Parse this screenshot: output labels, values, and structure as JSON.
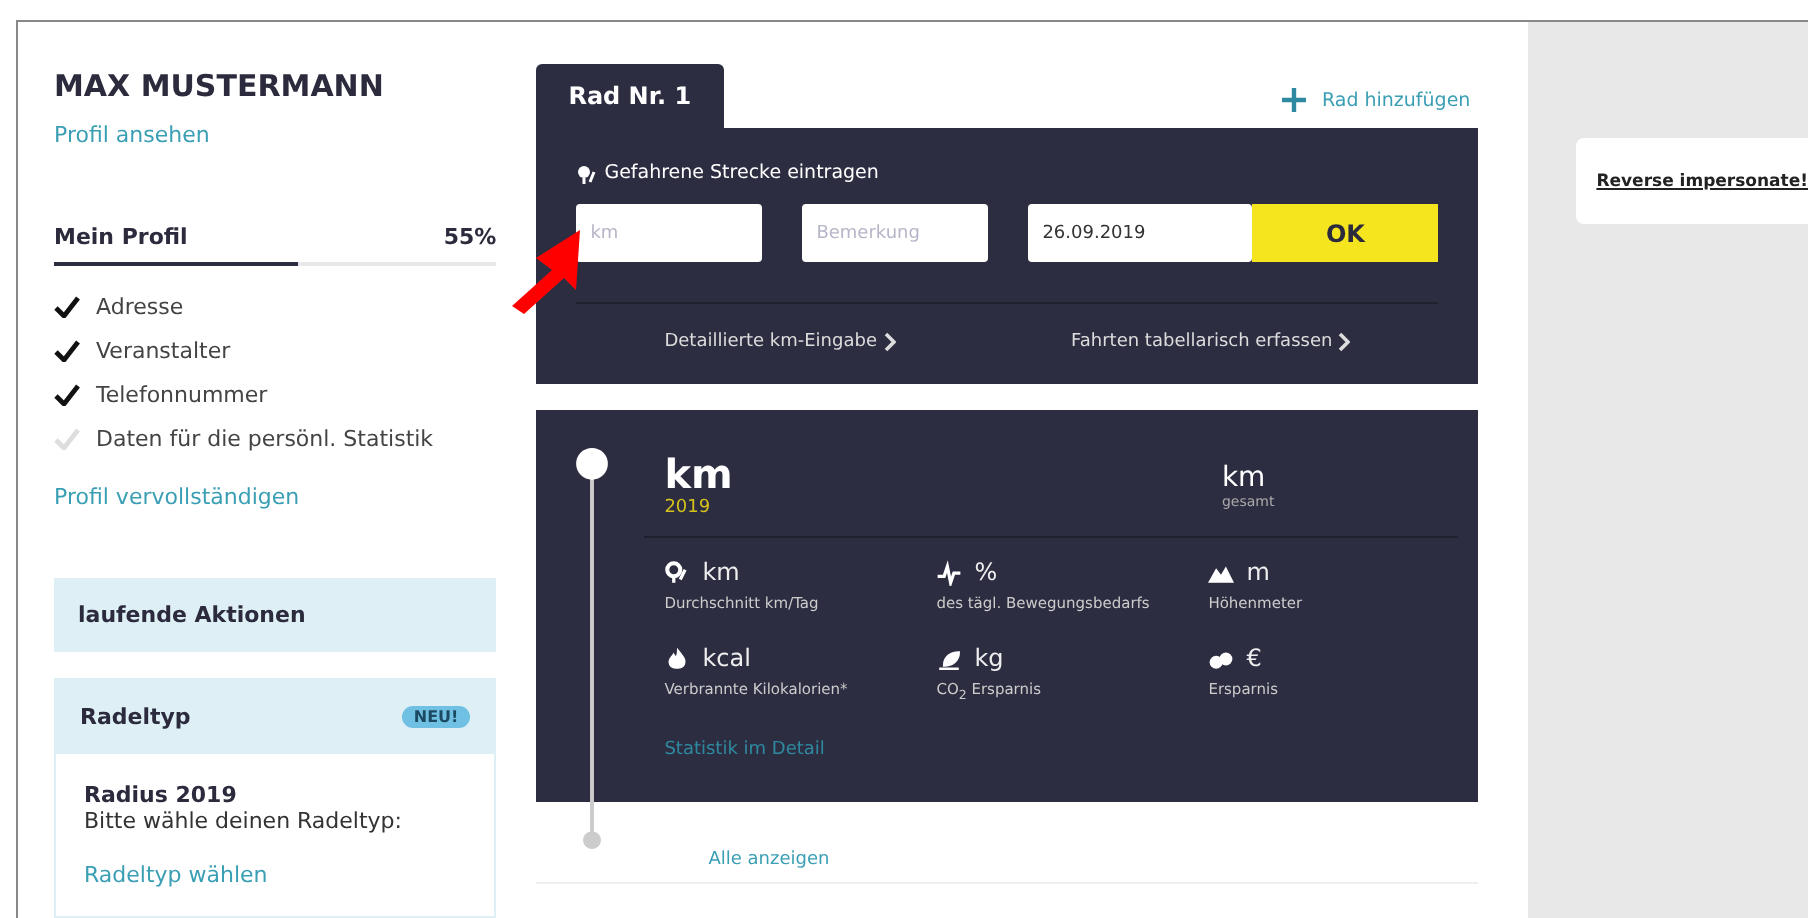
{
  "profile": {
    "name": "MAX MUSTERMANN",
    "view_link": "Profil ansehen",
    "progress_label": "Mein Profil",
    "progress_reading": "55%",
    "level": 0.55,
    "checklist": [
      {
        "label": "Adresse",
        "checked": true
      },
      {
        "label": "Veranstalter",
        "checked": true
      },
      {
        "label": "Telefonnummer",
        "checked": true
      },
      {
        "label": "Daten für die persönl. Statistik",
        "checked": false
      }
    ],
    "complete_link": "Profil vervollständigen"
  },
  "campaigns": {
    "title": "laufende Aktionen"
  },
  "cyclist_type": {
    "title": "Radeltyp",
    "badge": "NEU!",
    "subtitle": "Radius 2019",
    "text": "Bitte wähle deinen Radeltyp:",
    "link": "Radeltyp wählen"
  },
  "tabs": [
    {
      "label": "Rad Nr. 1",
      "selected": true
    }
  ],
  "add_bike": "Rad hinzufügen",
  "entry": {
    "title": "Gefahrene Strecke eintragen",
    "km_placeholder": "km",
    "note_placeholder": "Bemerkung",
    "date": "26.09.2019",
    "ok": "OK",
    "links": [
      "Detaillierte km-Eingabe",
      "Fahrten tabellarisch erfassen"
    ]
  },
  "stats": {
    "main_unit": "km",
    "year": "2019",
    "total_unit": "km",
    "total_label": "gesamt",
    "items": [
      {
        "kind": "route",
        "unit": "km",
        "label": "Durchschnitt km/Tag"
      },
      {
        "kind": "activity",
        "unit": "%",
        "label": "des tägl. Bewegungsbedarfs"
      },
      {
        "kind": "mountain",
        "unit": "m",
        "label": "Höhenmeter"
      },
      {
        "kind": "flame",
        "unit": "kcal",
        "label": "Verbrannte Kilokalorien*"
      },
      {
        "kind": "leaf",
        "unit": "kg",
        "label": "CO$_{2}$ Ersparnis"
      },
      {
        "kind": "coins",
        "unit": "€",
        "label": "Ersparnis"
      }
    ],
    "detail_link": "Statistik im Detail"
  },
  "show_all": "Alle anzeigen",
  "side_panel": {
    "link": "Reverse impersonate!"
  }
}
